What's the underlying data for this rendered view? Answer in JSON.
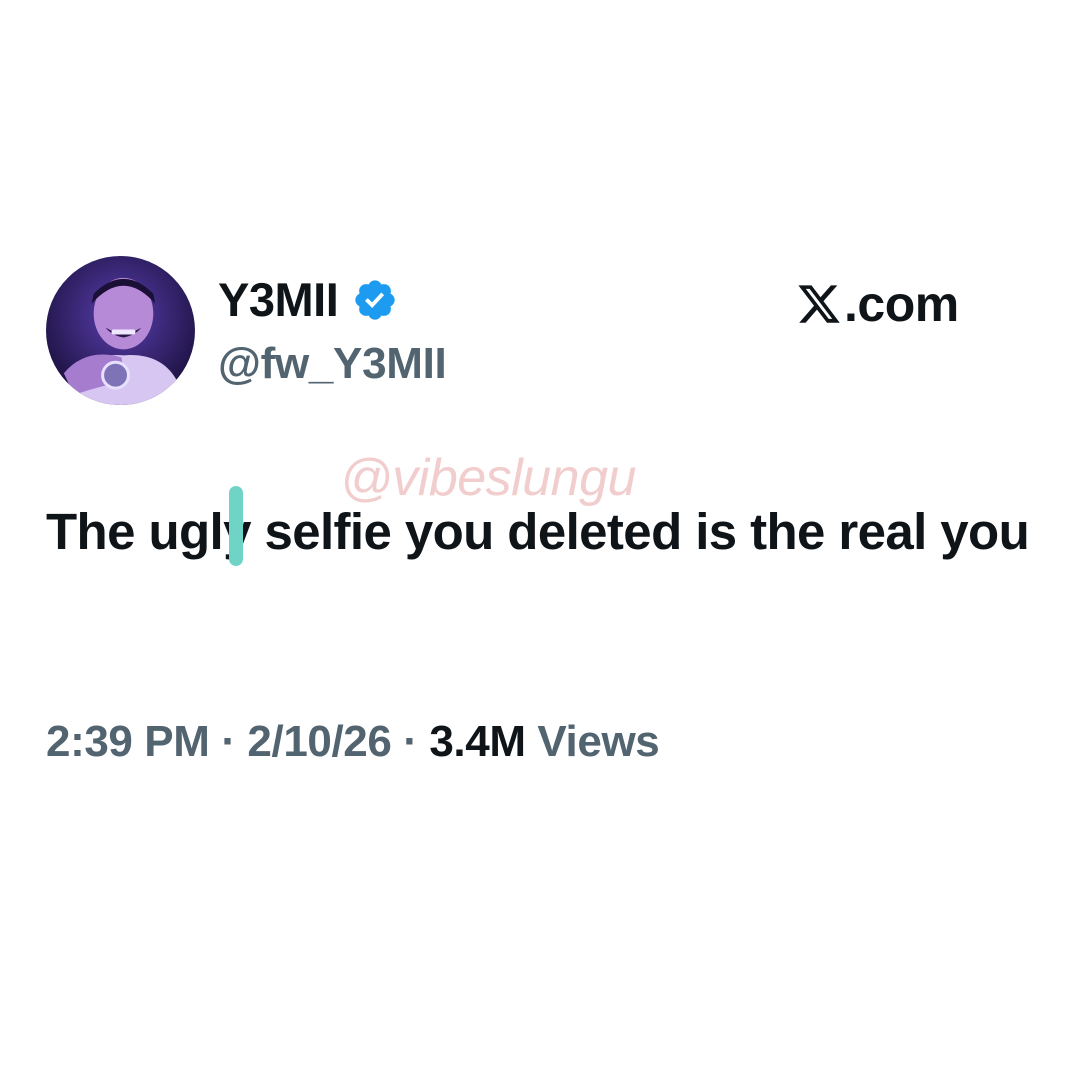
{
  "author": {
    "display_name": "Y3MII",
    "handle": "@fw_Y3MII",
    "verified_icon": "verified-badge-icon"
  },
  "brand": {
    "logo_icon": "x-logo-icon",
    "text": ".com"
  },
  "watermark": "@vibeslungu",
  "tweet": {
    "text": "The ugly selfie you deleted is the real you"
  },
  "meta": {
    "time": "2:39 PM",
    "separator": "·",
    "date": "2/10/26",
    "views_count": "3.4M",
    "views_label": "Views"
  },
  "colors": {
    "text_primary": "#0f1419",
    "text_secondary": "#536471",
    "verified_blue": "#1d9bf0",
    "watermark": "#f0c8c8",
    "cursor": "#6fd4c6"
  }
}
